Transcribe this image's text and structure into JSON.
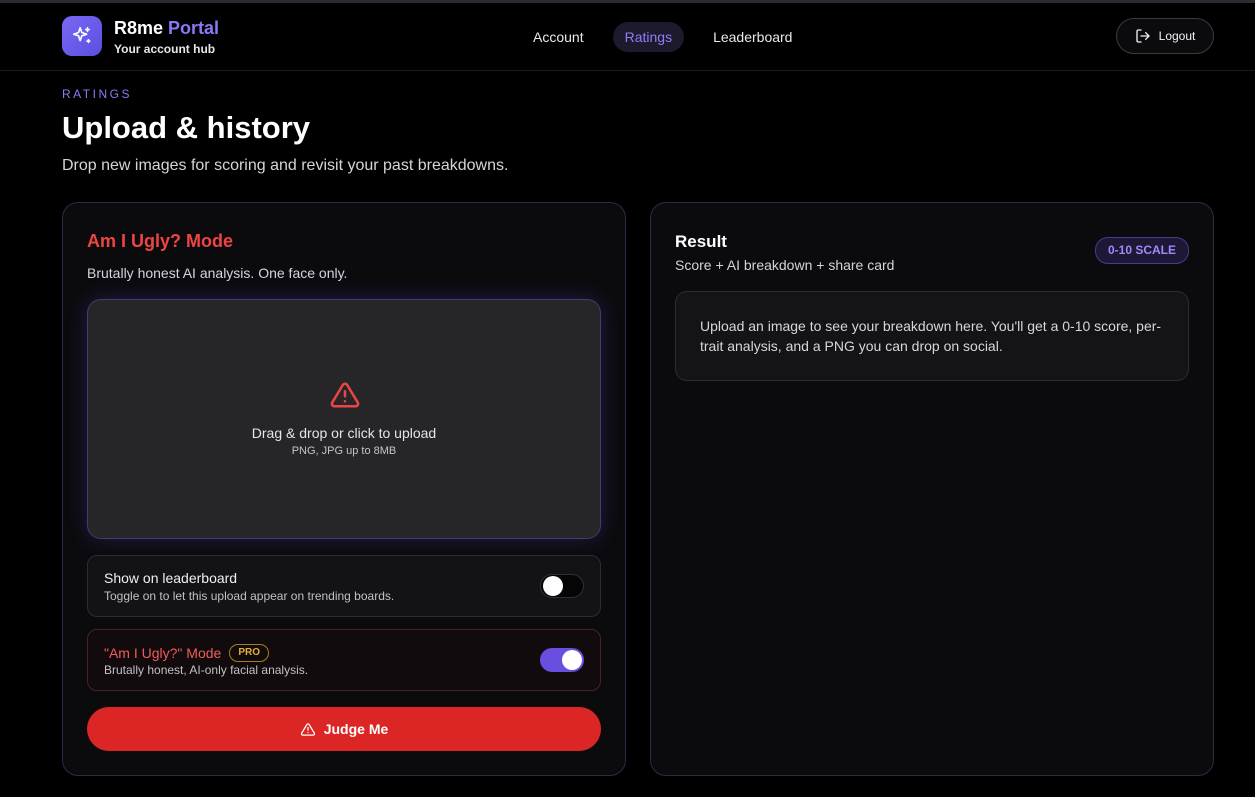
{
  "brand": {
    "name": "R8me",
    "accent": "Portal",
    "subtitle": "Your account hub",
    "icon": "sparkles-icon"
  },
  "nav": {
    "items": [
      {
        "label": "Account"
      },
      {
        "label": "Ratings",
        "active": true
      },
      {
        "label": "Leaderboard"
      }
    ]
  },
  "header": {
    "logout_label": "Logout",
    "logout_icon": "logout-icon"
  },
  "intro": {
    "eyebrow": "RATINGS",
    "title": "Upload & history",
    "description": "Drop new images for scoring and revisit your past breakdowns."
  },
  "upload": {
    "mode_title": "Am I Ugly? Mode",
    "mode_description": "Brutally honest AI analysis. One face only.",
    "dropzone_icon": "warning-icon",
    "dropzone_main": "Drag & drop or click to upload",
    "dropzone_sub": "PNG, JPG up to 8MB",
    "options": {
      "leaderboard": {
        "title": "Show on leaderboard",
        "subtitle": "Toggle on to let this upload appear on trending boards.",
        "enabled": false
      },
      "ugly_mode": {
        "title": "\"Am I Ugly?\" Mode",
        "badge": "PRO",
        "subtitle": "Brutally honest, AI-only facial analysis.",
        "enabled": true
      }
    },
    "submit_label": "Judge Me"
  },
  "result": {
    "title": "Result",
    "subtitle": "Score + AI breakdown + share card",
    "badge": "0-10 SCALE",
    "placeholder": "Upload an image to see your breakdown here. You'll get a 0-10 score, per-trait analysis, and a PNG you can drop on social."
  },
  "colors": {
    "accent": "#8b7af6",
    "danger": "#dc2626",
    "danger_text": "#ef4444",
    "pro": "#e0b13c",
    "background": "#000000"
  }
}
